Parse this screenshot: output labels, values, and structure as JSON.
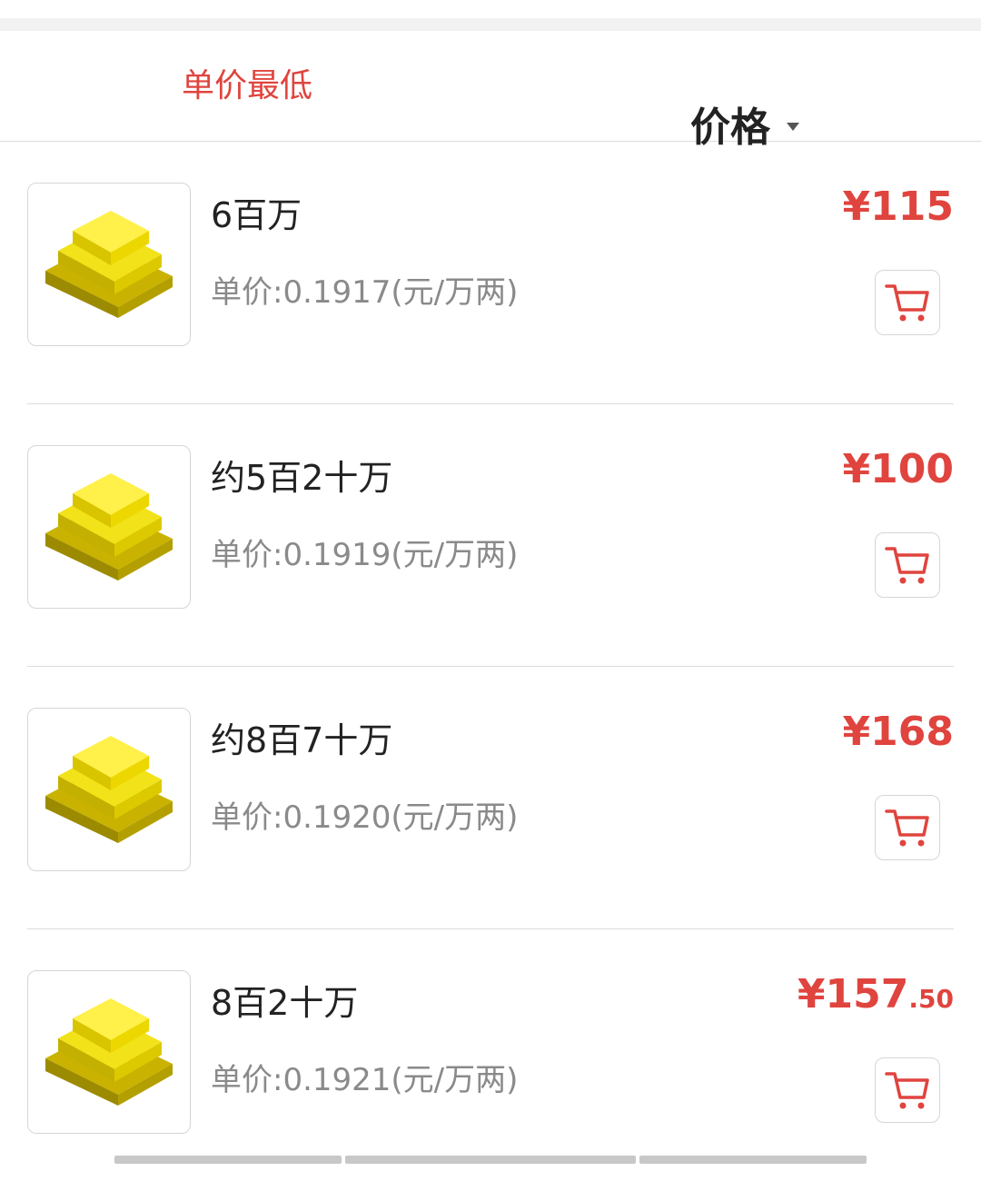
{
  "sort_bar": {
    "tab_lowest_unit_price": "单价最低",
    "tab_price": "价格"
  },
  "colors": {
    "accent": "#e0443e",
    "text_primary": "#222222",
    "text_secondary": "#8a8a8a",
    "divider": "#dcdcdc"
  },
  "items": [
    {
      "title": "6百万",
      "unit_price": "单价:0.1917(元/万两)",
      "price_main": "¥115",
      "price_cents": "",
      "icon": "gold-bars-icon"
    },
    {
      "title": "约5百2十万",
      "unit_price": "单价:0.1919(元/万两)",
      "price_main": "¥100",
      "price_cents": "",
      "icon": "gold-bars-icon"
    },
    {
      "title": "约8百7十万",
      "unit_price": "单价:0.1920(元/万两)",
      "price_main": "¥168",
      "price_cents": "",
      "icon": "gold-bars-icon"
    },
    {
      "title": "8百2十万",
      "unit_price": "单价:0.1921(元/万两)",
      "price_main": "¥157",
      "price_cents": ".50",
      "icon": "gold-bars-icon"
    }
  ]
}
